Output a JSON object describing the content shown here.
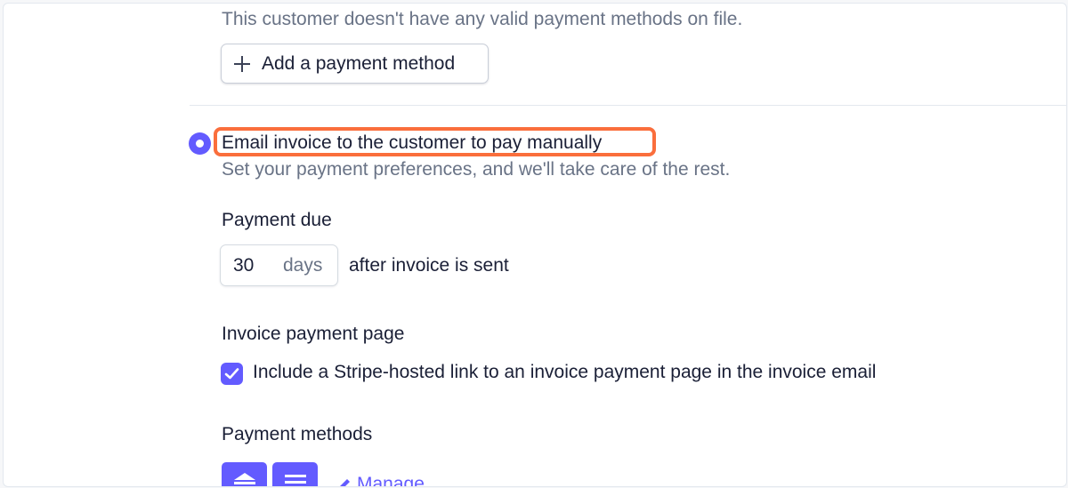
{
  "payment_methods_on_file": {
    "empty_text": "This customer doesn't have any valid payment methods on file.",
    "add_button_label": "Add a payment method"
  },
  "email_invoice_option": {
    "title": "Email invoice to the customer to pay manually",
    "subtitle": "Set your payment preferences, and we'll take care of the rest.",
    "selected": true
  },
  "payment_due": {
    "heading": "Payment due",
    "value": "30",
    "unit": "days",
    "after_text": "after invoice is sent"
  },
  "invoice_payment_page": {
    "heading": "Invoice payment page",
    "checkbox_label": "Include a Stripe-hosted link to an invoice payment page in the invoice email",
    "checked": true
  },
  "payment_methods": {
    "heading": "Payment methods",
    "tiles": [
      "bank-icon",
      "card-icon"
    ],
    "manage_label": "Manage"
  },
  "colors": {
    "accent": "#635bff",
    "highlight": "#fa6e3c",
    "muted_text": "#697386",
    "text": "#1a1f36"
  }
}
